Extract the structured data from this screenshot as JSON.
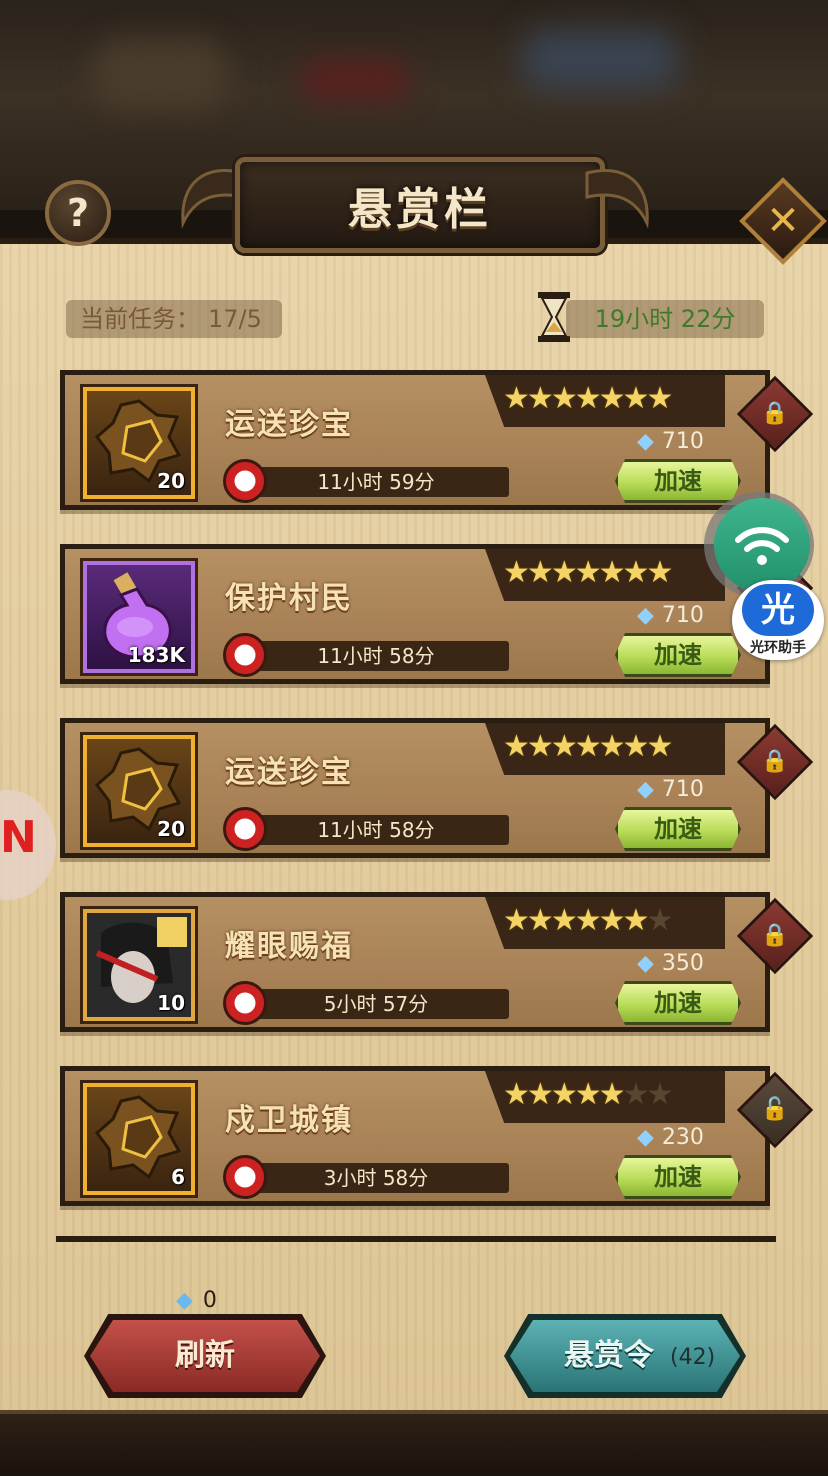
{
  "header": {
    "title": "悬赏栏",
    "help_label": "?",
    "close_label": "✕"
  },
  "status": {
    "tasks_label": "当前任务：",
    "tasks_value": "17/5",
    "refresh_timer": "19小时 22分"
  },
  "quests": [
    {
      "name": "运送珍宝",
      "icon": "treasure-chest-icon",
      "icon_count": "20",
      "timer": "11小时 59分",
      "stars_filled": 7,
      "stars_total": 7,
      "gem_cost": "710",
      "locked": true,
      "speed_label": "加速"
    },
    {
      "name": "保护村民",
      "icon": "potion-bottle-icon",
      "icon_count": "183K",
      "timer": "11小时 58分",
      "stars_filled": 7,
      "stars_total": 7,
      "gem_cost": "710",
      "locked": true,
      "speed_label": "加速"
    },
    {
      "name": "运送珍宝",
      "icon": "treasure-chest-icon",
      "icon_count": "20",
      "timer": "11小时 58分",
      "stars_filled": 7,
      "stars_total": 7,
      "gem_cost": "710",
      "locked": true,
      "speed_label": "加速"
    },
    {
      "name": "耀眼赐福",
      "icon": "hero-portrait-icon",
      "icon_count": "10",
      "timer": "5小时 57分",
      "stars_filled": 6,
      "stars_total": 7,
      "gem_cost": "350",
      "locked": true,
      "speed_label": "加速"
    },
    {
      "name": "戍卫城镇",
      "icon": "treasure-chest-icon",
      "icon_count": "6",
      "timer": "3小时 58分",
      "stars_filled": 5,
      "stars_total": 7,
      "gem_cost": "230",
      "locked": false,
      "speed_label": "加速"
    }
  ],
  "footer": {
    "refresh_cost": "0",
    "refresh_label": "刷新",
    "bounty_label": "悬赏令",
    "bounty_count": "(42)"
  },
  "overlays": {
    "assistant_logo": "光",
    "assistant_label": "光环助手"
  },
  "colors": {
    "panel": "#e2cb9c",
    "card": "#a88256",
    "speed_button": "#b8dc58",
    "refresh_button": "#c4504a",
    "bounty_button": "#5cb2b4",
    "star": "#f5d466"
  }
}
